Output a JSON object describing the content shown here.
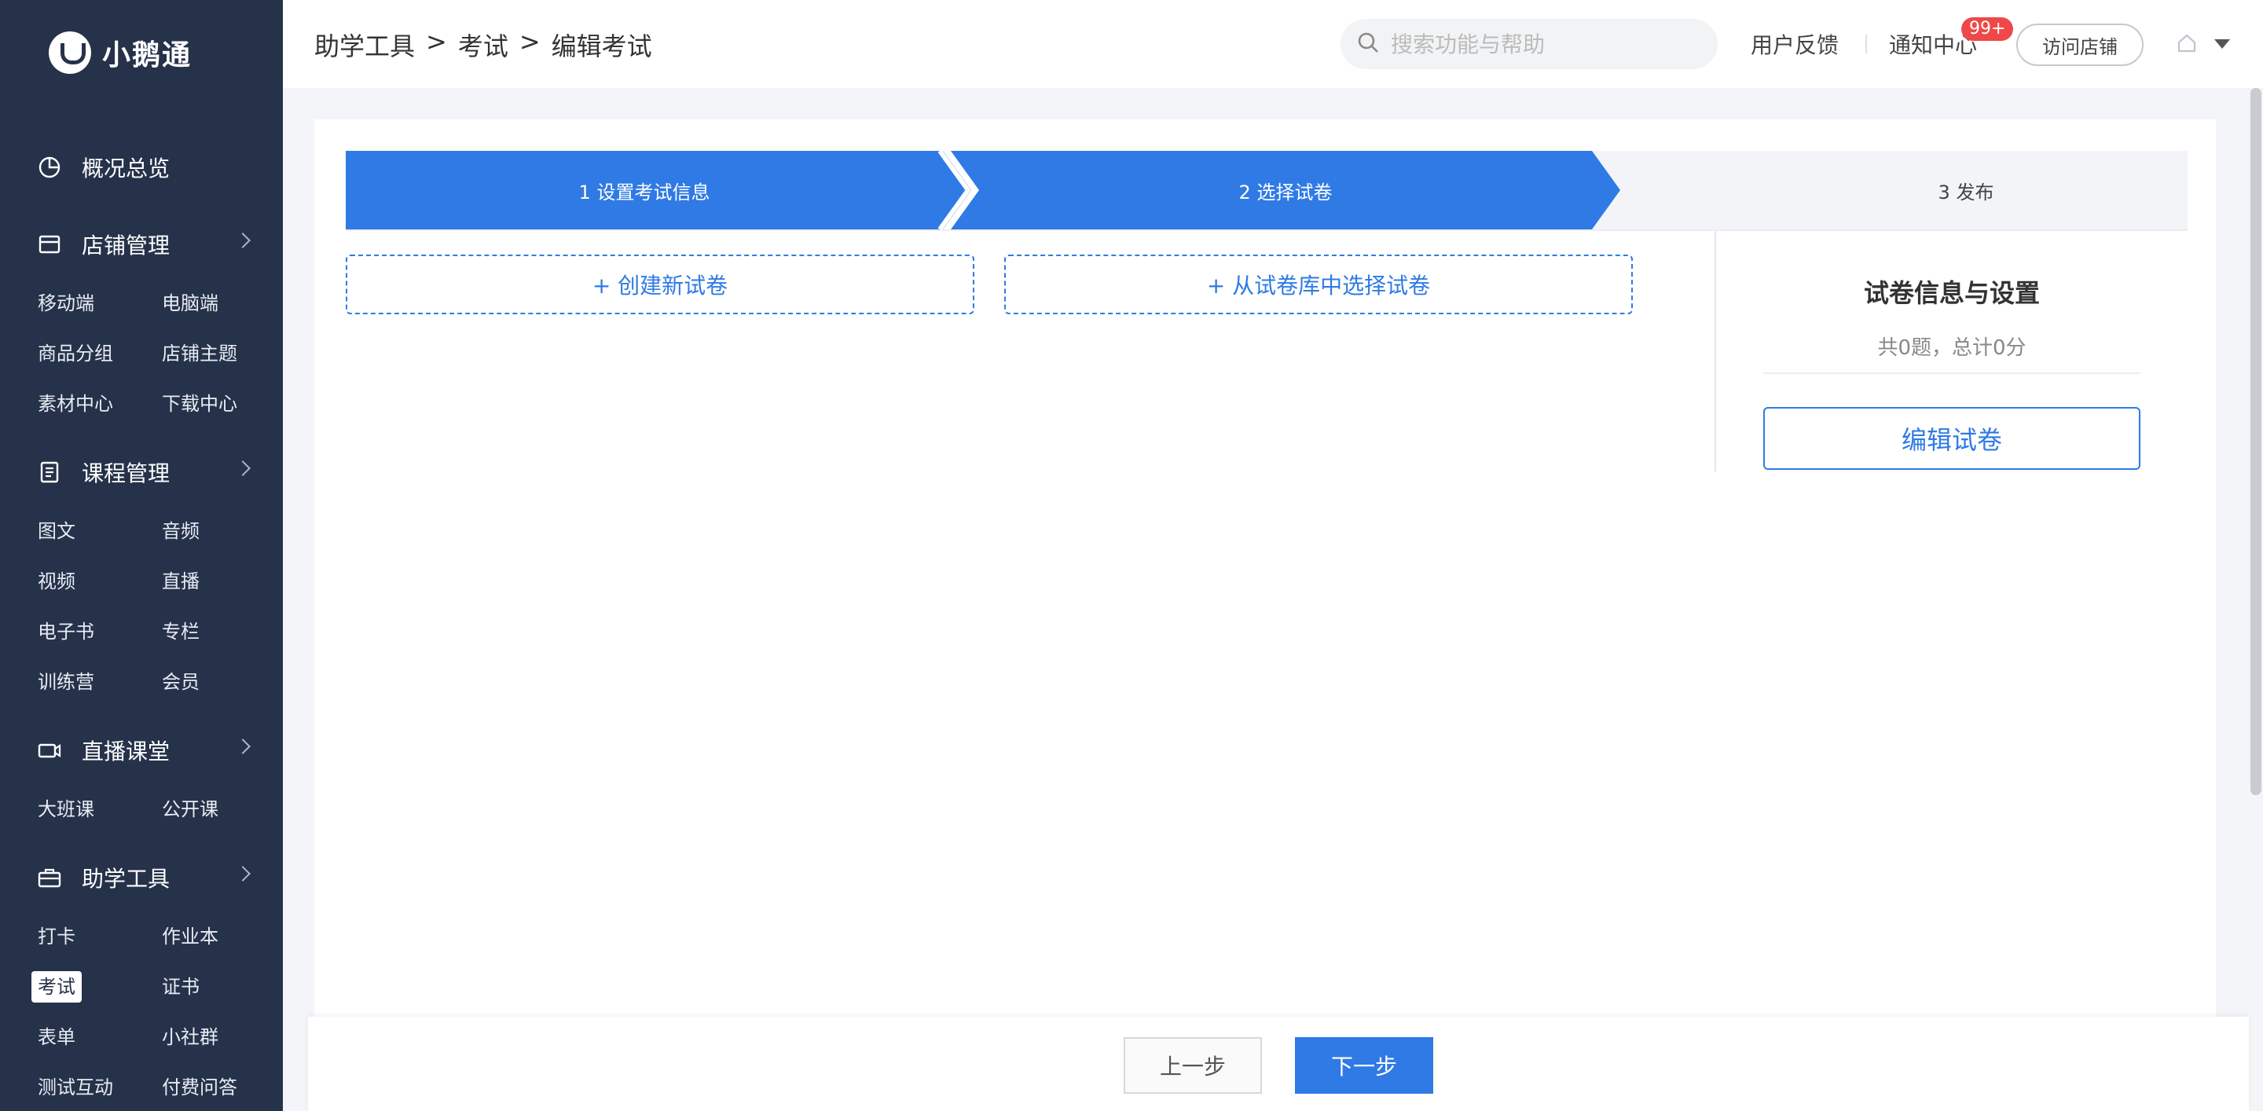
{
  "app": {
    "name": "小鹅通"
  },
  "sidebar": {
    "groups": [
      {
        "title": "概况总览",
        "icon": "pie-chart-icon"
      },
      {
        "title": "店铺管理",
        "icon": "store-icon",
        "items": [
          "移动端",
          "电脑端",
          "商品分组",
          "店铺主题",
          "素材中心",
          "下载中心"
        ]
      },
      {
        "title": "课程管理",
        "icon": "document-icon",
        "items": [
          "图文",
          "音频",
          "视频",
          "直播",
          "电子书",
          "专栏",
          "训练营",
          "会员"
        ]
      },
      {
        "title": "直播课堂",
        "icon": "video-camera-icon",
        "items": [
          "大班课",
          "公开课"
        ]
      },
      {
        "title": "助学工具",
        "icon": "toolbox-icon",
        "items": [
          "打卡",
          "作业本",
          "考试",
          "证书",
          "表单",
          "小社群",
          "测试互动",
          "付费问答"
        ]
      }
    ],
    "active_item": "考试"
  },
  "header": {
    "breadcrumb": [
      "助学工具",
      ">",
      "考试",
      ">",
      "编辑考试"
    ],
    "search_placeholder": "搜索功能与帮助",
    "feedback": "用户反馈",
    "notifications": "通知中心",
    "notification_badge": "99+",
    "visit_store": "访问店铺"
  },
  "steps": [
    {
      "label": "1 设置考试信息",
      "state": "done"
    },
    {
      "label": "2 选择试卷",
      "state": "active"
    },
    {
      "label": "3 发布",
      "state": "pending"
    }
  ],
  "actions": {
    "create_paper": "+ 创建新试卷",
    "choose_from_bank": "+ 从试卷库中选择试卷"
  },
  "panel": {
    "title": "试卷信息与设置",
    "summary": "共0题，总计0分",
    "edit_button": "编辑试卷"
  },
  "footer": {
    "prev": "上一步",
    "next": "下一步"
  },
  "colors": {
    "sidebar_bg": "#26324a",
    "primary": "#2f7ae5",
    "badge": "#f04848"
  }
}
